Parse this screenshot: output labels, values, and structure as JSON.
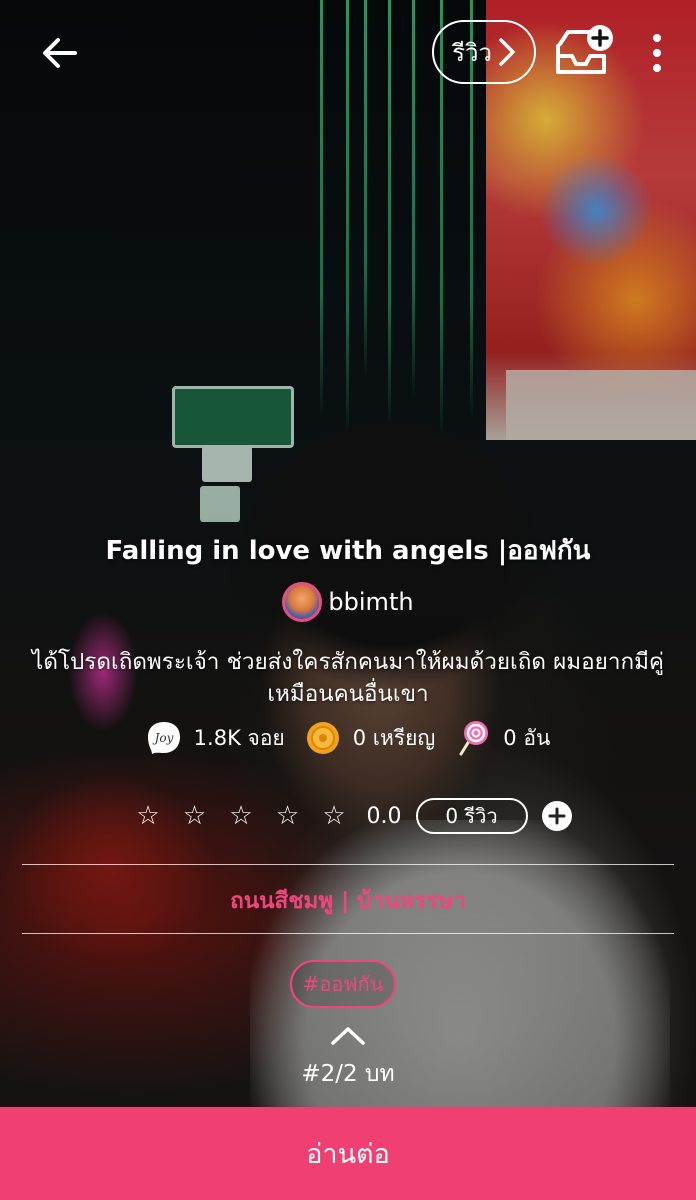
{
  "header": {
    "review_label": "รีวิว"
  },
  "story": {
    "title": "Falling in love with angels |ออฟกัน",
    "author": "bbimth",
    "description": "ได้โปรดเถิดพระเจ้า ช่วยส่งใครสักคนมาให้ผมด้วยเถิด ผมอยากมีคู่เหมือนคนอื่นเขา"
  },
  "stats": {
    "joy": "1.8K จอย",
    "coins": "0 เหรียญ",
    "candy": "0 อัน"
  },
  "rating": {
    "stars_filled": 0,
    "stars_total": 5,
    "value": "0.0",
    "review_button": "0 รีวิว"
  },
  "categories": "ถนนสีชมพู | บ้านหรรษา",
  "tag": "#ออฟกัน",
  "chapter": "#2/2 บท",
  "read_button": "อ่านต่อ",
  "colors": {
    "accent": "#ef3f73",
    "category_text": "#f0457f"
  },
  "icons": {
    "back": "arrow-left-icon",
    "review_chevron": "chevron-right-icon",
    "add_to_shelf": "inbox-plus-icon",
    "more": "more-vertical-icon",
    "joy": "joy-badge-icon",
    "coin": "coin-icon",
    "candy": "lollipop-icon",
    "star": "star-outline-icon",
    "add": "plus-circle-icon",
    "collapse": "chevron-up-icon"
  }
}
